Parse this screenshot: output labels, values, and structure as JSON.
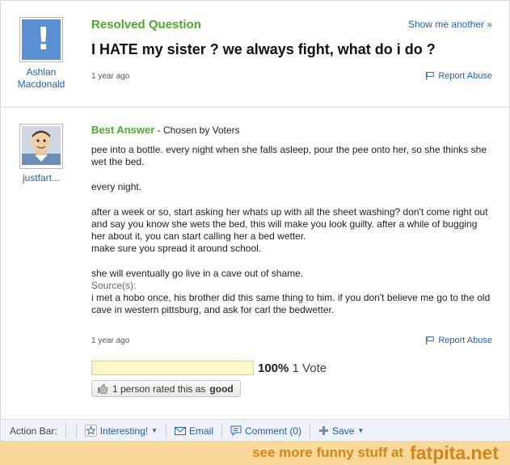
{
  "question": {
    "status": "Resolved Question",
    "show_another": "Show me another »",
    "title": "I HATE my sister ? we always fight, what do i do ?",
    "time": "1 year ago",
    "report": "Report Abuse",
    "author": "Ashlan Macdonald"
  },
  "answer": {
    "best_label": "Best Answer",
    "chosen_by": " - Chosen by Voters",
    "author": "justfart...",
    "paragraphs": [
      "pee into a bottle. every night when she falls asleep, pour the pee onto her, so she thinks she wet the bed.",
      "every night.",
      "after a week or so, start asking her whats up with all the sheet washing? don't come right out and say you know she wets the bed, this will make you look guilty. after a while of bugging her about it, you can start calling her a bed wetter.",
      "make sure you spread it around school.",
      "she will eventually go live in a cave out of shame."
    ],
    "sources_label": "Source(s):",
    "source_text": "i met a hobo once, his brother did this same thing to him. if you don't believe me go to the old cave in western pittsburg, and ask for carl the bedwetter.",
    "time": "1 year ago",
    "report": "Report Abuse",
    "vote_percent": "100%",
    "vote_count": "1 Vote",
    "vote_fraction": 1.0,
    "rated_prefix": "1 person rated this as",
    "rated_value": "good"
  },
  "action_bar": {
    "label": "Action Bar:",
    "interesting": "Interesting!",
    "email": "Email",
    "comment": "Comment (0)",
    "save": "Save"
  },
  "banner": {
    "message": "see more funny stuff at",
    "brand": "fatpita.net"
  },
  "colors": {
    "link": "#1f5fb8",
    "green": "#4ea82a",
    "banner_bg": "#f9d89a",
    "banner_text": "#d0861a"
  }
}
